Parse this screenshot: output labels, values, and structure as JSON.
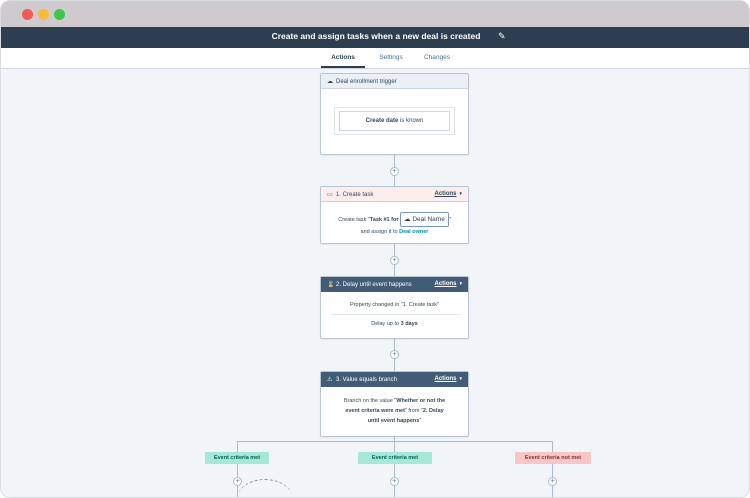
{
  "window": {
    "title": "Create and assign tasks when a new deal is created",
    "colors": {
      "titlebar": "#2d3e50",
      "accent_link": "#0091ae",
      "branch_green": "#a6e7d8",
      "branch_red": "#f8c6c7"
    }
  },
  "tabs": [
    {
      "label": "Actions",
      "active": true
    },
    {
      "label": "Settings",
      "active": false
    },
    {
      "label": "Changes",
      "active": false
    }
  ],
  "trigger": {
    "header": "Deal enrollment trigger",
    "filter_prop": "Create date",
    "filter_rest": " is known"
  },
  "step1": {
    "header": "1. Create task",
    "actions_label": "Actions",
    "line1_prefix": "Create task \"",
    "task_name": "Task #1 for",
    "chip_label": "Deal Name",
    "line1_suffix": "\"",
    "line2_prefix": "and assign it to ",
    "assignee": "Deal owner"
  },
  "step2": {
    "header": "2. Delay until event happens",
    "actions_label": "Actions",
    "line1": "Property changed in \"1. Create task\"",
    "line2_prefix": "Delay up to ",
    "line2_value": "3 days"
  },
  "step3": {
    "header": "3. Value equals branch",
    "actions_label": "Actions",
    "p1": "Branch on the value \"",
    "b1": "Whether or not the event criteria were met",
    "p2": "\" from \"",
    "b2": "2. Delay until event happens",
    "p3": "\""
  },
  "branches": [
    {
      "label": "Event criteria met",
      "color": "green"
    },
    {
      "label": "Event criteria met",
      "color": "green"
    },
    {
      "label": "Event criteria not met",
      "color": "red"
    }
  ],
  "icons": {
    "trigger": "deal-icon",
    "step1": "task-icon",
    "step2": "hourglass-icon",
    "step3": "branch-warning-icon",
    "title_edit": "pencil-icon"
  }
}
